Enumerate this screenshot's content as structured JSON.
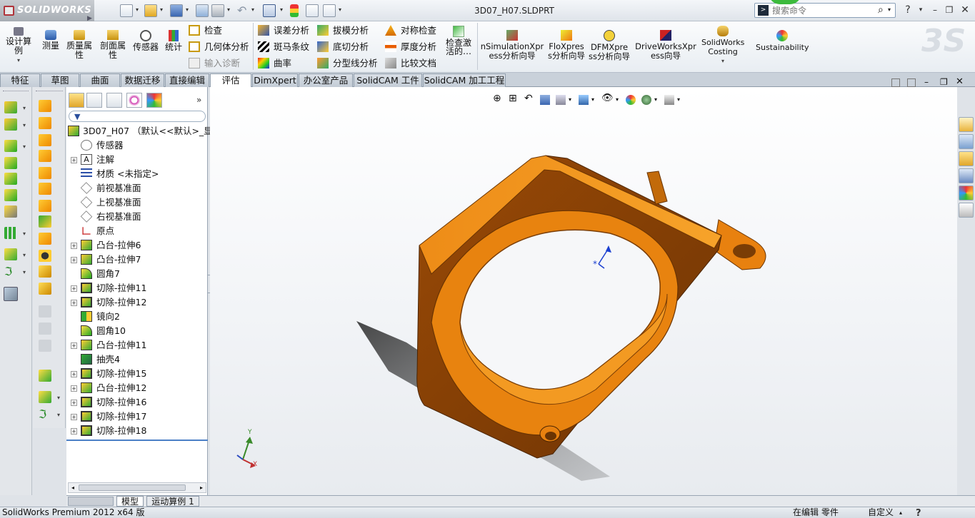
{
  "app": {
    "logo_text": "SOLIDWORKS",
    "document_title": "3D07_H07.SLDPRT",
    "search_placeholder": "搜索命令"
  },
  "ribbon": {
    "big_buttons": [
      {
        "id": "design-study",
        "label": "设计算例"
      },
      {
        "id": "measure",
        "label": "测量"
      },
      {
        "id": "mass-properties",
        "label": "质量属性"
      },
      {
        "id": "section-properties",
        "label": "剖面属性"
      },
      {
        "id": "sensor",
        "label": "传感器"
      },
      {
        "id": "statistics",
        "label": "统计"
      }
    ],
    "col1": [
      {
        "id": "check",
        "label": "检查"
      },
      {
        "id": "geometry-analysis",
        "label": "几何体分析"
      },
      {
        "id": "import-diagnostics",
        "label": "输入诊断"
      }
    ],
    "col2": [
      {
        "id": "deviation-analysis",
        "label": "误差分析"
      },
      {
        "id": "zebra-stripes",
        "label": "斑马条纹"
      },
      {
        "id": "curvature",
        "label": "曲率"
      }
    ],
    "col3": [
      {
        "id": "draft-analysis",
        "label": "拔模分析"
      },
      {
        "id": "undercut-analysis",
        "label": "底切分析"
      },
      {
        "id": "parting-line-analysis",
        "label": "分型线分析"
      }
    ],
    "col4": [
      {
        "id": "symmetry-check",
        "label": "对称检查"
      },
      {
        "id": "thickness-analysis",
        "label": "厚度分析"
      },
      {
        "id": "compare-documents",
        "label": "比较文档"
      }
    ],
    "check_active": "检查激活的…",
    "xpress": [
      {
        "id": "simulationxpress",
        "label": "nSimulationXpress分析向导"
      },
      {
        "id": "floxpress",
        "label": "FloXpress分析向导"
      },
      {
        "id": "dfmxpress",
        "label": "DFMXpress分析向导"
      },
      {
        "id": "driveworksxpress",
        "label": "DriveWorksXpress向导"
      },
      {
        "id": "costing",
        "label": "SolidWorks Costing"
      },
      {
        "id": "sustainability",
        "label": "Sustainability"
      }
    ]
  },
  "tabs": [
    {
      "id": "features",
      "label": "特征"
    },
    {
      "id": "sketch",
      "label": "草图"
    },
    {
      "id": "surfaces",
      "label": "曲面"
    },
    {
      "id": "data-migration",
      "label": "数据迁移"
    },
    {
      "id": "direct-editing",
      "label": "直接编辑"
    },
    {
      "id": "evaluate",
      "label": "评估"
    },
    {
      "id": "dimxpert",
      "label": "DimXpert"
    },
    {
      "id": "office-products",
      "label": "办公室产品"
    },
    {
      "id": "solidcam-parts",
      "label": "SolidCAM 工件"
    },
    {
      "id": "solidcam-machining",
      "label": "SolidCAM 加工工程"
    }
  ],
  "tree": {
    "root": "3D07_H07 （默认<<默认>_显示",
    "items": [
      {
        "label": "传感器",
        "icon": "sensor"
      },
      {
        "label": "注解",
        "icon": "annotation",
        "expand": true
      },
      {
        "label": "材质 <未指定>",
        "icon": "material"
      },
      {
        "label": "前视基准面",
        "icon": "plane"
      },
      {
        "label": "上视基准面",
        "icon": "plane"
      },
      {
        "label": "右视基准面",
        "icon": "plane"
      },
      {
        "label": "原点",
        "icon": "origin"
      },
      {
        "label": "凸台-拉伸6",
        "icon": "boss",
        "expand": true
      },
      {
        "label": "凸台-拉伸7",
        "icon": "boss",
        "expand": true
      },
      {
        "label": "圆角7",
        "icon": "fillet"
      },
      {
        "label": "切除-拉伸11",
        "icon": "cut",
        "expand": true
      },
      {
        "label": "切除-拉伸12",
        "icon": "cut",
        "expand": true
      },
      {
        "label": "镜向2",
        "icon": "mirror"
      },
      {
        "label": "圆角10",
        "icon": "fillet"
      },
      {
        "label": "凸台-拉伸11",
        "icon": "boss",
        "expand": true
      },
      {
        "label": "抽壳4",
        "icon": "shell"
      },
      {
        "label": "切除-拉伸15",
        "icon": "cut",
        "expand": true
      },
      {
        "label": "凸台-拉伸12",
        "icon": "boss",
        "expand": true
      },
      {
        "label": "切除-拉伸16",
        "icon": "cut",
        "expand": true
      },
      {
        "label": "切除-拉伸17",
        "icon": "cut",
        "expand": true
      },
      {
        "label": "切除-拉伸18",
        "icon": "cut",
        "expand": true
      }
    ]
  },
  "bottom_tabs": [
    {
      "id": "model",
      "label": "模型"
    },
    {
      "id": "motion-study",
      "label": "运动算例 1"
    }
  ],
  "status": {
    "product": "SolidWorks Premium 2012 x64 版",
    "editing": "在编辑 零件",
    "units": "自定义"
  },
  "triad": {
    "x": "X",
    "y": "Y"
  },
  "colors": {
    "part": "#e8810f",
    "part_dark": "#7a3d05",
    "accent": "#2a5ea8"
  }
}
